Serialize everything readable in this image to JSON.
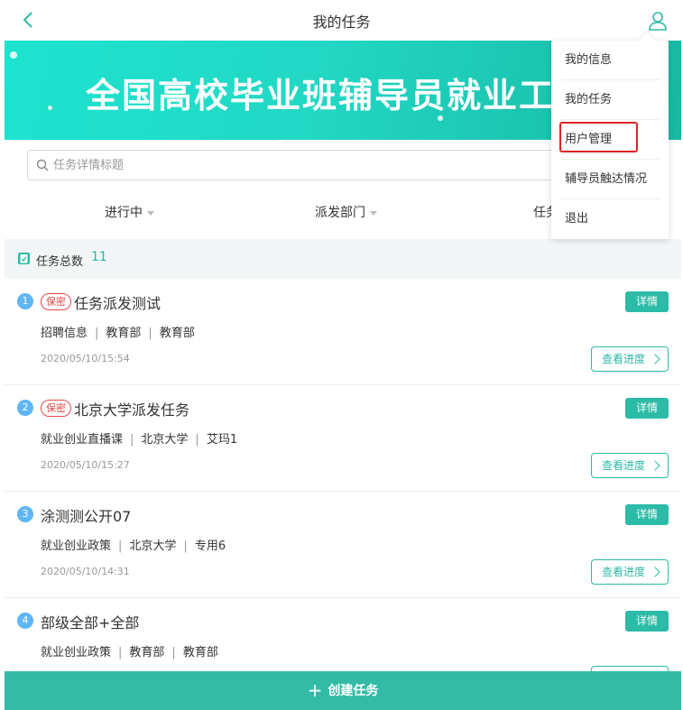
{
  "header": {
    "title": "我的任务"
  },
  "banner": {
    "text": "全国高校毕业班辅导员就业工作平"
  },
  "search": {
    "placeholder": "任务详情标题",
    "value": ""
  },
  "filters": [
    {
      "label": "进行中"
    },
    {
      "label": "派发部门"
    },
    {
      "label": "任务"
    }
  ],
  "summary": {
    "label": "任务总数",
    "count": "11"
  },
  "tasks": [
    {
      "index": "1",
      "secret": "保密",
      "name": "任务派发测试",
      "meta": [
        "招聘信息",
        "教育部",
        "教育部"
      ],
      "time": "2020/05/10/15:54",
      "detail_label": "详情",
      "progress_label": "查看进度"
    },
    {
      "index": "2",
      "secret": "保密",
      "name": "北京大学派发任务",
      "meta": [
        "就业创业直播课",
        "北京大学",
        "艾玛1"
      ],
      "time": "2020/05/10/15:27",
      "detail_label": "详情",
      "progress_label": "查看进度"
    },
    {
      "index": "3",
      "secret": "",
      "name": "涂测测公开07",
      "meta": [
        "就业创业政策",
        "北京大学",
        "专用6"
      ],
      "time": "2020/05/10/14:31",
      "detail_label": "详情",
      "progress_label": "查看进度"
    },
    {
      "index": "4",
      "secret": "",
      "name": "部级全部+全部",
      "meta": [
        "就业创业政策",
        "教育部",
        "教育部"
      ],
      "time": "",
      "detail_label": "详情",
      "progress_label": ""
    }
  ],
  "create_button": {
    "label": "创建任务"
  },
  "menu": {
    "items": [
      {
        "label": "我的信息"
      },
      {
        "label": "我的任务"
      },
      {
        "label": "用户管理"
      },
      {
        "label": "辅导员触达情况"
      },
      {
        "label": "退出"
      }
    ],
    "highlighted_index": 2
  },
  "colors": {
    "accent": "#2bbba6",
    "secret": "#e04a4a",
    "index_badge": "#5fb6f5",
    "highlight": "#e02424"
  }
}
